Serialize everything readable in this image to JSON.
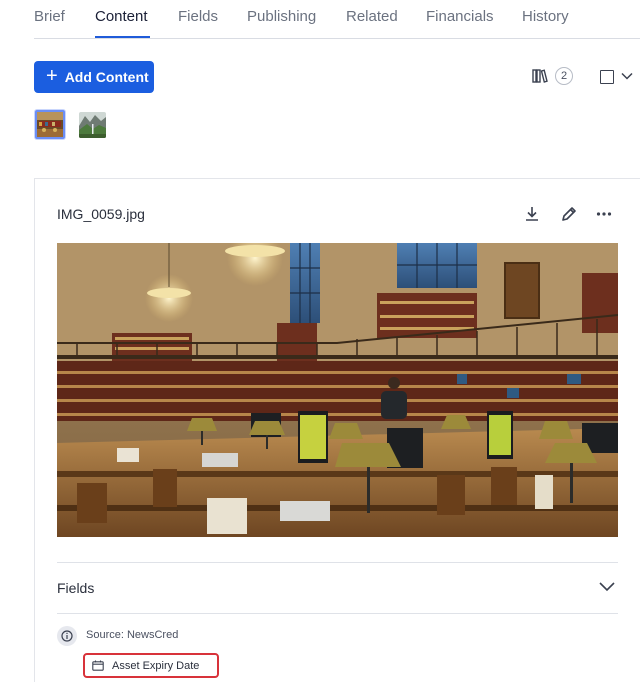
{
  "tabs": [
    {
      "label": "Brief",
      "active": false
    },
    {
      "label": "Content",
      "active": true
    },
    {
      "label": "Fields",
      "active": false
    },
    {
      "label": "Publishing",
      "active": false
    },
    {
      "label": "Related",
      "active": false
    },
    {
      "label": "Financials",
      "active": false
    },
    {
      "label": "History",
      "active": false
    }
  ],
  "toolbar": {
    "add_label": "Add Content",
    "plus_glyph": "+",
    "library_icon": "library-books-icon",
    "count": "2",
    "select_icon": "checkbox-icon",
    "select_menu_icon": "chevron-down-icon"
  },
  "thumbnails": [
    {
      "name": "library-reading-room-thumbnail",
      "selected": true
    },
    {
      "name": "mountain-waterfall-thumbnail",
      "selected": false
    }
  ],
  "asset": {
    "filename": "IMG_0059.jpg",
    "actions": [
      "download-icon",
      "edit-pencil-icon",
      "more-options-icon"
    ],
    "image_subject": "library reading room"
  },
  "fields": {
    "title": "Fields",
    "source": "Source: NewsCred",
    "expiry_label": "Asset Expiry Date"
  },
  "colors": {
    "accent": "#1b5ee0",
    "tab_underline": "#1f5bd9",
    "highlight": "#d8323a"
  }
}
